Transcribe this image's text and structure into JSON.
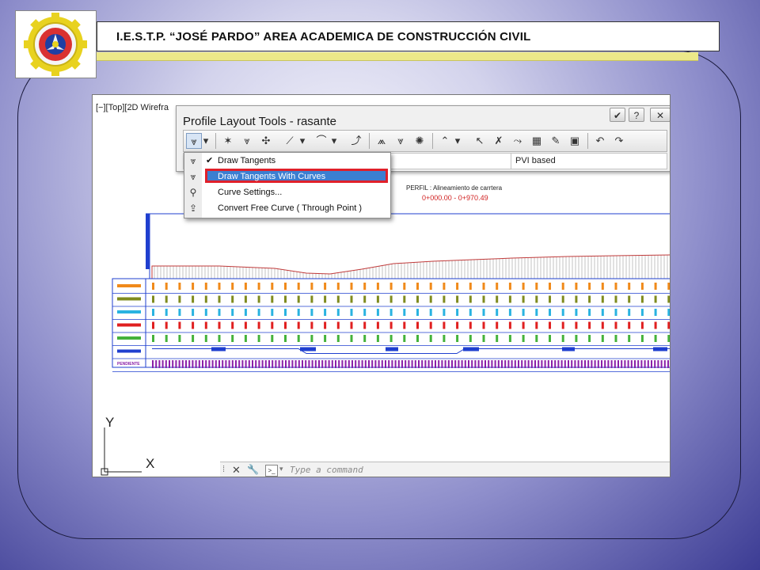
{
  "slide": {
    "title": "I.E.S.T.P. “JOSÉ PARDO” AREA ACADEMICA DE CONSTRUCCIÓN CIVIL",
    "logo_icon": "institute-gear-seal-logo",
    "accent_bar_color": "#ece889"
  },
  "cad": {
    "viewport_label": "[−][Top][2D Wirefra",
    "panel": {
      "title": "Profile Layout Tools - rasante",
      "window_buttons": [
        "✔",
        "?",
        "✕"
      ],
      "pvi_label": "PVI based"
    },
    "dropdown": {
      "items": [
        {
          "label": "Draw Tangents",
          "checked": true,
          "icon": "tangent-icon"
        },
        {
          "label": "Draw Tangents With Curves",
          "checked": false,
          "icon": "tangent-curve-icon"
        },
        {
          "label": "Curve Settings...",
          "checked": false,
          "icon": "curve-settings-icon"
        },
        {
          "label": "Convert Free Curve ( Through Point )",
          "checked": false,
          "icon": "convert-curve-icon"
        }
      ],
      "highlight_color": "#e0202a"
    },
    "profile": {
      "title": "PERFIL : Alineamiento de carrtera",
      "station": "0+000.00  -  0+970.49",
      "band_label": "PENDIENTE",
      "band_colors": [
        "#f08a1a",
        "#7f8b1f",
        "#29b3e0",
        "#e02020",
        "#44b23b",
        "#1f3fcf",
        "#8a1fa8"
      ]
    },
    "command_line": {
      "placeholder": "Type a command",
      "close": "✕"
    },
    "ucs": {
      "x": "X",
      "y": "Y"
    }
  }
}
